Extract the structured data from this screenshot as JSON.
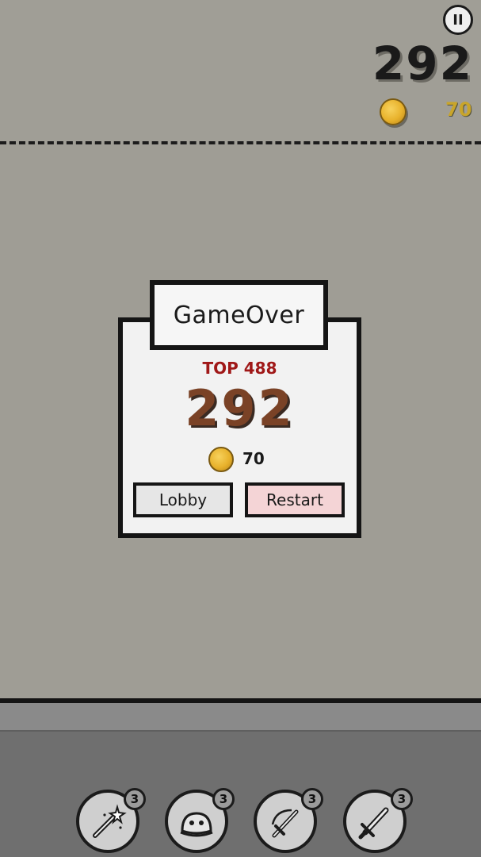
{
  "hud": {
    "pause_label": "II",
    "score": "292",
    "coins": "70"
  },
  "dialog": {
    "title": "GameOver",
    "top_rank": "TOP 488",
    "score": "292",
    "coins": "70",
    "lobby_label": "Lobby",
    "restart_label": "Restart"
  },
  "items": [
    {
      "name": "magic-wand-icon",
      "count": "3"
    },
    {
      "name": "slime-icon",
      "count": "3"
    },
    {
      "name": "swing-sword-icon",
      "count": "3"
    },
    {
      "name": "sword-icon",
      "count": "3"
    }
  ],
  "colors": {
    "background": "#9f9d95",
    "floor": "#6f6f6f",
    "top_rank_red": "#a01818",
    "score_brown": "#7a4226",
    "coin_gold": "#e8b22c",
    "restart_pink": "#f4d4d6"
  }
}
